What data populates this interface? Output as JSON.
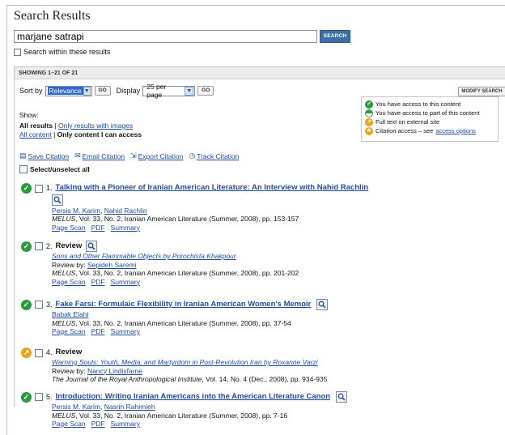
{
  "page": {
    "title": "Search Results"
  },
  "search": {
    "query": "marjane satrapi",
    "button": "SEARCH",
    "within_label": "Search within these results"
  },
  "showing": "SHOWING 1–21 OF 21",
  "sort": {
    "sort_label": "Sort by",
    "sort_value": "Relevance",
    "go1": "GO",
    "display_label": "Display",
    "display_value": "25 per page",
    "go2": "GO",
    "modify": "MODIFY SEARCH"
  },
  "show": {
    "label": "Show:",
    "all_results": "All results",
    "only_images": "Only results with images",
    "all_content": "All content",
    "only_access": "Only content I can access",
    "sep": " | "
  },
  "tools": {
    "save": "Save Citation",
    "email": "Email Citation",
    "export": "Export Citation",
    "track": "Track Citation"
  },
  "select_all": "Select/unselect all",
  "legend": {
    "full": "You have access to this content",
    "part": "You have access to part of this content",
    "ext": "Full text on external site",
    "cit_pre": "Citation access – see ",
    "cit_link": "access options"
  },
  "colors": {
    "link": "#1f4a9c",
    "access_green": "#2b9a3f",
    "external_orange": "#e8a319",
    "search_button": "#3d6fa6"
  },
  "results": [
    {
      "num": "1.",
      "access": "full",
      "title": "Talking with a Pioneer of Iranian American Literature: An Interview with Nahid Rachlin",
      "authors": [
        "Persis M. Karim",
        "Nahid Rachlin"
      ],
      "journal": "MELUS",
      "source": ", Vol. 33, No. 2, Iranian American Literature (Summer, 2008), pp. 153-157",
      "links": [
        "Page Scan",
        "PDF",
        "Summary"
      ]
    },
    {
      "num": "2.",
      "access": "full",
      "title": "Review",
      "reviewed": "Sons and Other Flammable Objects by Porochista Khakpour",
      "review_by_label": "Review by: ",
      "reviewer": "Sepideh Saremi",
      "journal": "MELUS",
      "source": ", Vol. 33, No. 2, Iranian American Literature (Summer, 2008), pp. 201-202",
      "links": [
        "Page Scan",
        "PDF",
        "Summary"
      ]
    },
    {
      "num": "3.",
      "access": "full",
      "title": "Fake Farsi: Formulaic Flexibility in Iranian American Women's Memoir",
      "authors": [
        "Babak Elahi"
      ],
      "journal": "MELUS",
      "source": ", Vol. 33, No. 2, Iranian American Literature (Summer, 2008), pp. 37-54",
      "links": [
        "Page Scan",
        "PDF",
        "Summary"
      ]
    },
    {
      "num": "4.",
      "access": "external",
      "title": "Review",
      "reviewed": "Warning Souls: Youth, Media, and Martyrdom in Post-Revolution Iran by Roxanne Varzi",
      "review_by_label": "Review by: ",
      "reviewer": "Nancy Lindisfarne",
      "journal": "The Journal of the Royal Anthropological Institute",
      "source": ", Vol. 14, No. 4 (Dec., 2008), pp. 934-935"
    },
    {
      "num": "5.",
      "access": "full",
      "title": "Introduction: Writing Iranian Americans into the American Literature Canon",
      "authors": [
        "Persis M. Karim",
        "Nasrin Rahimieh"
      ],
      "journal": "MELUS",
      "source": ", Vol. 33, No. 2, Iranian American Literature (Summer, 2008), pp. 7-16",
      "links": [
        "Page Scan",
        "PDF",
        "Summary"
      ]
    }
  ]
}
